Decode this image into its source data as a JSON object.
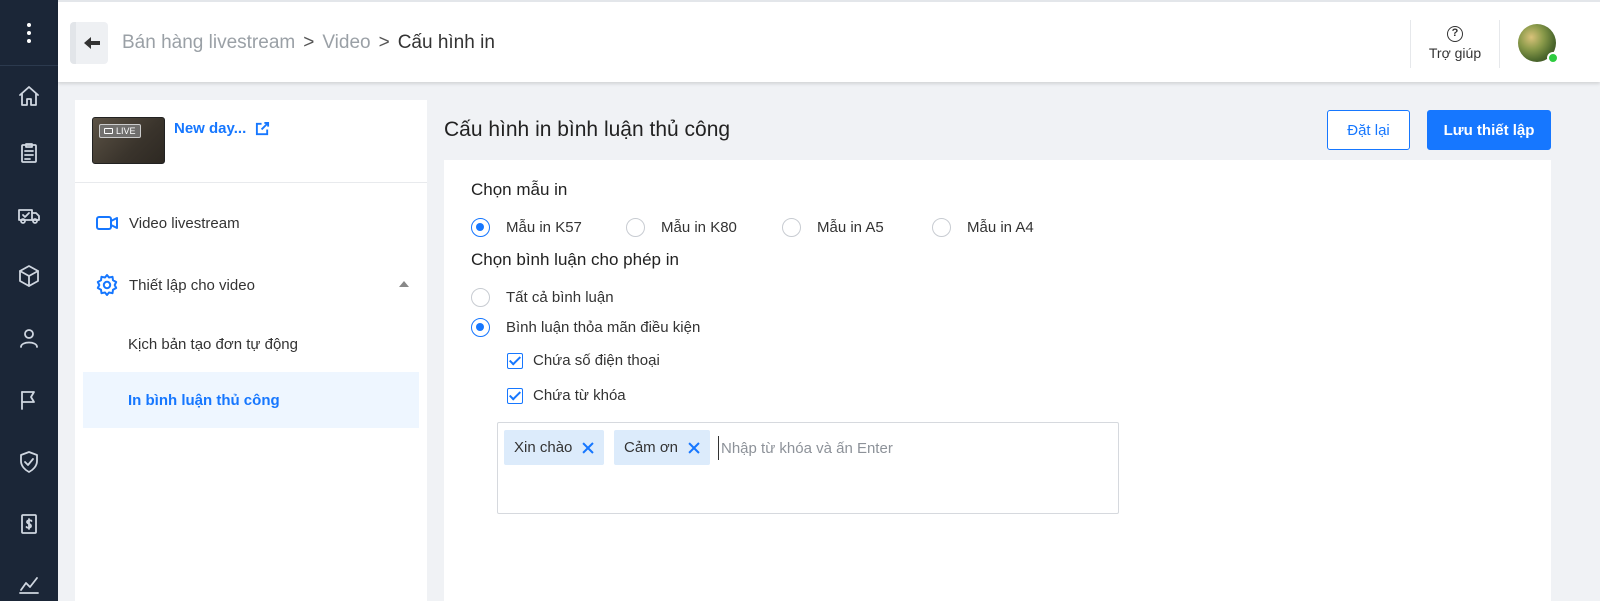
{
  "breadcrumb": {
    "items": [
      "Bán hàng livestream",
      "Video",
      "Cấu hình in"
    ],
    "separator": ">"
  },
  "header": {
    "help_label": "Trợ giúp",
    "help_icon": "?"
  },
  "sidebar": {
    "video": {
      "title": "New day...",
      "badge": "LIVE"
    },
    "items": [
      {
        "label": "Video livestream"
      },
      {
        "label": "Thiết lập cho video"
      },
      {
        "label": "Kịch bản tạo đơn tự động"
      },
      {
        "label": "In bình luận thủ công"
      }
    ]
  },
  "main": {
    "title": "Cấu hình in bình luận thủ công",
    "reset_label": "Đặt lại",
    "save_label": "Lưu thiết lập",
    "template_section": {
      "title": "Chọn mẫu in",
      "options": [
        "Mẫu in K57",
        "Mẫu in K80",
        "Mẫu in A5",
        "Mẫu in A4"
      ],
      "selected": "Mẫu in K57"
    },
    "comment_section": {
      "title": "Chọn bình luận cho phép in",
      "options": [
        "Tất cả bình luận",
        "Bình luận thỏa mãn điều kiện"
      ],
      "selected": "Bình luận thỏa mãn điều kiện",
      "conditions": [
        {
          "label": "Chứa số điện thoại",
          "checked": true
        },
        {
          "label": "Chứa từ khóa",
          "checked": true
        }
      ],
      "keywords": [
        "Xin chào",
        "Cảm ơn"
      ],
      "keyword_placeholder": "Nhập từ khóa và ấn Enter"
    }
  },
  "colors": {
    "accent": "#1677ff",
    "rail": "#1b2637",
    "active_bg": "#eef6ff"
  }
}
